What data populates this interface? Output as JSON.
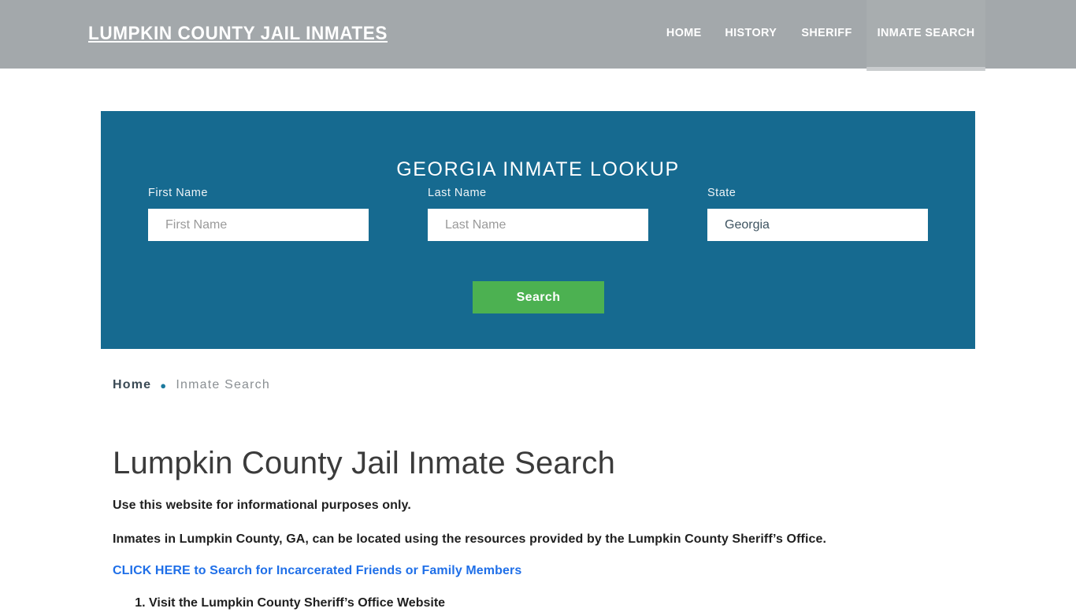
{
  "header": {
    "site_title": "LUMPKIN COUNTY JAIL INMATES",
    "background_color": "#a3a8ab",
    "nav": [
      {
        "label": "HOME",
        "active": false
      },
      {
        "label": "HISTORY",
        "active": false
      },
      {
        "label": "SHERIFF",
        "active": false
      },
      {
        "label": "INMATE SEARCH",
        "active": true
      }
    ]
  },
  "lookup_panel": {
    "title": "GEORGIA INMATE LOOKUP",
    "panel_color": "#166a90",
    "fields": {
      "first_name": {
        "label": "First Name",
        "placeholder": "First Name",
        "value": ""
      },
      "last_name": {
        "label": "Last Name",
        "placeholder": "Last Name",
        "value": ""
      },
      "state": {
        "label": "State",
        "value": "Georgia"
      }
    },
    "search_button": {
      "label": "Search",
      "color": "#4cb151"
    }
  },
  "breadcrumb": {
    "home": "Home",
    "separator": "●",
    "current": "Inmate Search"
  },
  "main": {
    "page_title": "Lumpkin County Jail Inmate Search",
    "paragraph_1": "Use this website for informational purposes only.",
    "paragraph_2": "Inmates in Lumpkin County, GA, can be located using the resources provided by the Lumpkin County Sheriff’s Office.",
    "cta_link": "CLICK HERE to Search for Incarcerated Friends or Family Members",
    "cta_link_color": "#1f6fe8",
    "steps": [
      "Visit the Lumpkin County Sheriff’s Office Website"
    ]
  }
}
